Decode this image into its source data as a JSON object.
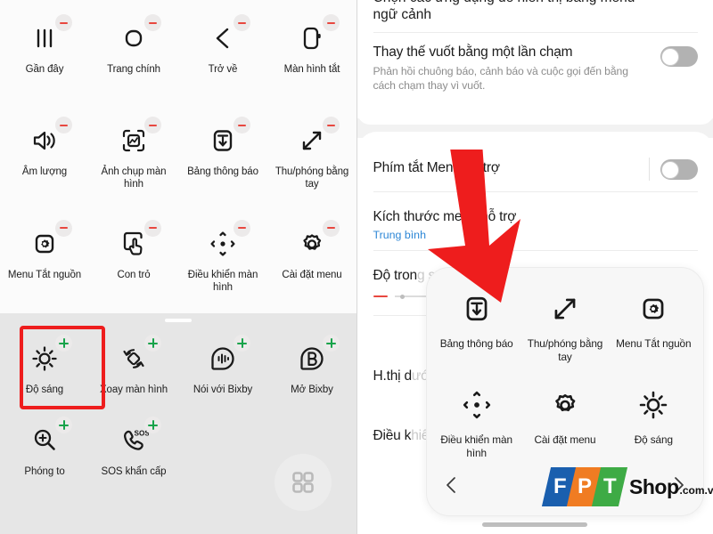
{
  "left_panel": {
    "section_title": "assistant-menu-edit-grid",
    "active_items": [
      {
        "label": "Gần đây",
        "icon": "recents-icon",
        "badge": "minus"
      },
      {
        "label": "Trang chính",
        "icon": "home-icon",
        "badge": "minus"
      },
      {
        "label": "Trở về",
        "icon": "back-chevron-icon",
        "badge": "minus"
      },
      {
        "label": "Màn hình tắt",
        "icon": "screen-off-icon",
        "badge": "minus"
      },
      {
        "label": "Âm lượng",
        "icon": "volume-icon",
        "badge": "minus"
      },
      {
        "label": "Ảnh chụp màn hình",
        "icon": "screenshot-icon",
        "badge": "minus"
      },
      {
        "label": "Bảng thông báo",
        "icon": "notification-panel-icon",
        "badge": "minus"
      },
      {
        "label": "Thu/phóng bằng tay",
        "icon": "zoom-diagonal-icon",
        "badge": "minus"
      },
      {
        "label": "Menu Tắt nguồn",
        "icon": "power-menu-icon",
        "badge": "minus"
      },
      {
        "label": "Con trỏ",
        "icon": "pointer-icon",
        "badge": "minus"
      },
      {
        "label": "Điều khiển màn hình",
        "icon": "screen-control-icon",
        "badge": "minus"
      },
      {
        "label": "Cài đặt menu",
        "icon": "settings-gear-icon",
        "badge": "minus"
      }
    ],
    "available_items": [
      {
        "label": "Độ sáng",
        "icon": "brightness-icon",
        "badge": "plus",
        "highlighted": true
      },
      {
        "label": "Xoay màn hình",
        "icon": "rotate-screen-icon",
        "badge": "plus",
        "highlighted": false
      },
      {
        "label": "Nói với Bixby",
        "icon": "bixby-voice-icon",
        "badge": "plus",
        "highlighted": false
      },
      {
        "label": "Mở Bixby",
        "icon": "bixby-open-icon",
        "badge": "plus",
        "highlighted": false
      },
      {
        "label": "Phóng to",
        "icon": "magnify-icon",
        "badge": "plus",
        "highlighted": false
      },
      {
        "label": "SOS khẩn cấp",
        "icon": "sos-call-icon",
        "badge": "plus",
        "highlighted": false
      }
    ],
    "apps_button": "apps-grid-icon"
  },
  "right_panel": {
    "cut_off_row": "ngữ cảnh",
    "rows": [
      {
        "title": "Thay thế vuốt bằng một lần chạm",
        "subtitle": "Phản hồi chuông báo, cảnh báo và cuộc gọi đến bằng cách chạm thay vì vuốt.",
        "control": "toggle",
        "toggle_state": "off"
      },
      {
        "title": "Phím tắt Menu hỗ trợ",
        "control": "toggle",
        "toggle_state": "off"
      },
      {
        "title": "Kích thước menu hỗ trợ",
        "value": "Trung bình",
        "control": "value"
      },
      {
        "title": "Độ trong suốt",
        "control": "slider",
        "slider": {
          "min_label": "−",
          "max_label": "+",
          "position_percent": 18
        }
      },
      {
        "title": "H.thị dưới dạng biểu tượng cạnh",
        "control": "toggle",
        "toggle_state": "off"
      },
      {
        "title": "Điều khiển con trỏ và bảng cảm ứng",
        "control": "none"
      }
    ]
  },
  "popup": {
    "items": [
      {
        "label": "Bảng thông báo",
        "icon": "notification-panel-icon"
      },
      {
        "label": "Thu/phóng bằng tay",
        "icon": "zoom-diagonal-icon"
      },
      {
        "label": "Menu Tắt nguồn",
        "icon": "power-menu-icon"
      },
      {
        "label": "Điều khiển màn hình",
        "icon": "screen-control-icon"
      },
      {
        "label": "Cài đặt menu",
        "icon": "settings-gear-icon"
      },
      {
        "label": "Độ sáng",
        "icon": "brightness-icon"
      }
    ],
    "prev_icon": "chevron-left-icon",
    "next_icon": "chevron-right-icon"
  },
  "watermark": {
    "letters": [
      "F",
      "P",
      "T"
    ],
    "colors": [
      "#1a5fae",
      "#f07c22",
      "#3eab45"
    ],
    "shop_text": "Shop",
    "domain_text": ".com.vn"
  },
  "annotation": {
    "arrow": "red-down-arrow",
    "arrow_color": "#ee1d1d",
    "highlight_color": "#ee1d1d"
  }
}
